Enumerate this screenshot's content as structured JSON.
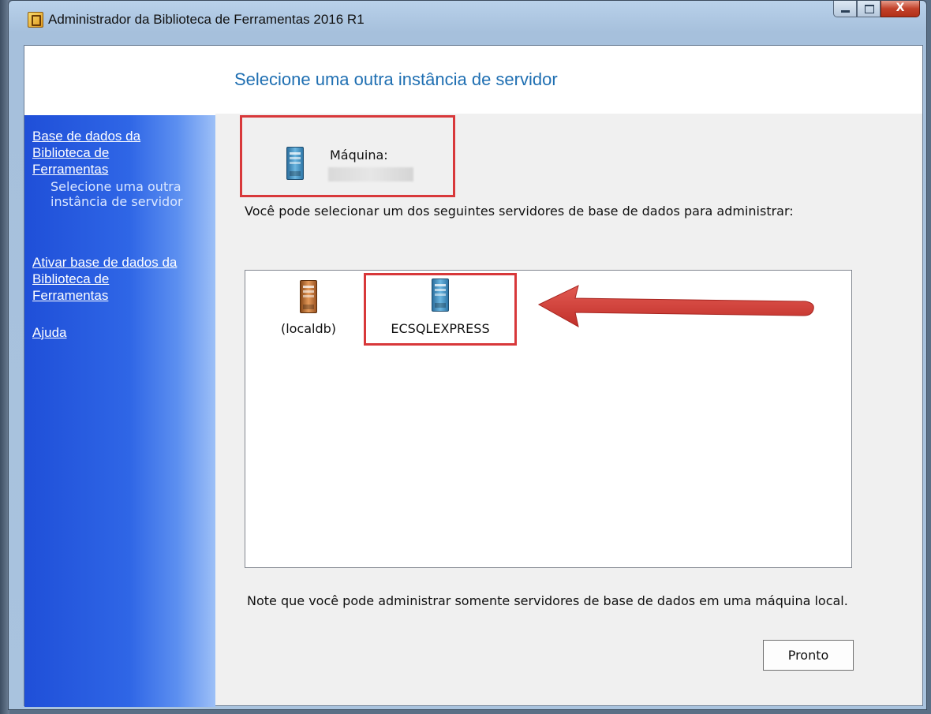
{
  "window": {
    "title": "Administrador da Biblioteca de Ferramentas 2016 R1",
    "close_glyph": "X"
  },
  "page": {
    "title": "Selecione uma outra instância de servidor"
  },
  "sidebar": {
    "items": [
      {
        "label": "Base de dados da Biblioteca de Ferramentas",
        "type": "link"
      },
      {
        "label": "Selecione uma outra instância de servidor",
        "type": "current"
      },
      {
        "label": "Ativar base de dados da Biblioteca de Ferramentas",
        "type": "link"
      },
      {
        "label": "Ajuda",
        "type": "link"
      }
    ]
  },
  "machine": {
    "label": "Máquina:"
  },
  "servers": {
    "prompt": "Você pode selecionar um dos seguintes servidores de base de dados para administrar:",
    "items": [
      {
        "label": "(localdb)",
        "icon": "server-orange-icon"
      },
      {
        "label": "ECSQLEXPRESS",
        "icon": "server-blue-icon"
      }
    ]
  },
  "note": "Note que você pode administrar somente servidores de base de dados em uma máquina local.",
  "buttons": {
    "done": "Pronto"
  },
  "colors": {
    "title_blue": "#1f6fb2",
    "annotation_red": "#d8383a",
    "sidebar_blue": "#2f66e6"
  }
}
